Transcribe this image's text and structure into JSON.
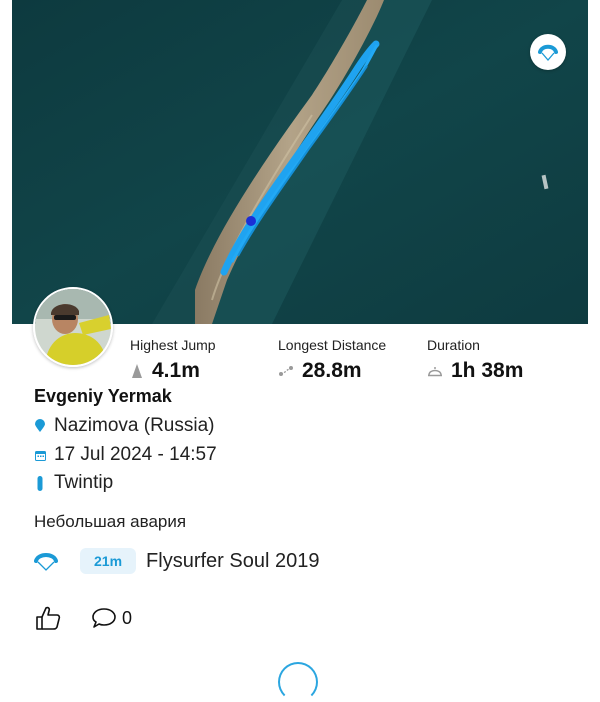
{
  "session": {
    "rider_name": "Evgeniy Yermak",
    "location": "Nazimova (Russia)",
    "datetime": "17 Jul 2024 - 14:57",
    "board_type": "Twintip",
    "description": "Небольшая авария"
  },
  "stats": {
    "highest_jump_label": "Highest Jump",
    "highest_jump_value": "4.1m",
    "longest_distance_label": "Longest Distance",
    "longest_distance_value": "28.8m",
    "duration_label": "Duration",
    "duration_value": "1h 38m"
  },
  "gear": {
    "kite_size": "21m",
    "kite_name": "Flysurfer Soul 2019"
  },
  "social": {
    "comment_count": "0"
  },
  "colors": {
    "accent": "#1b9ad6",
    "track": "#1fa3f0",
    "sea": "#0f3d42"
  },
  "icons": {
    "kite": "kite-icon",
    "location": "map-pin-icon",
    "date": "calendar-icon",
    "board": "board-icon",
    "like": "thumbs-up-icon",
    "comment": "comment-icon"
  }
}
